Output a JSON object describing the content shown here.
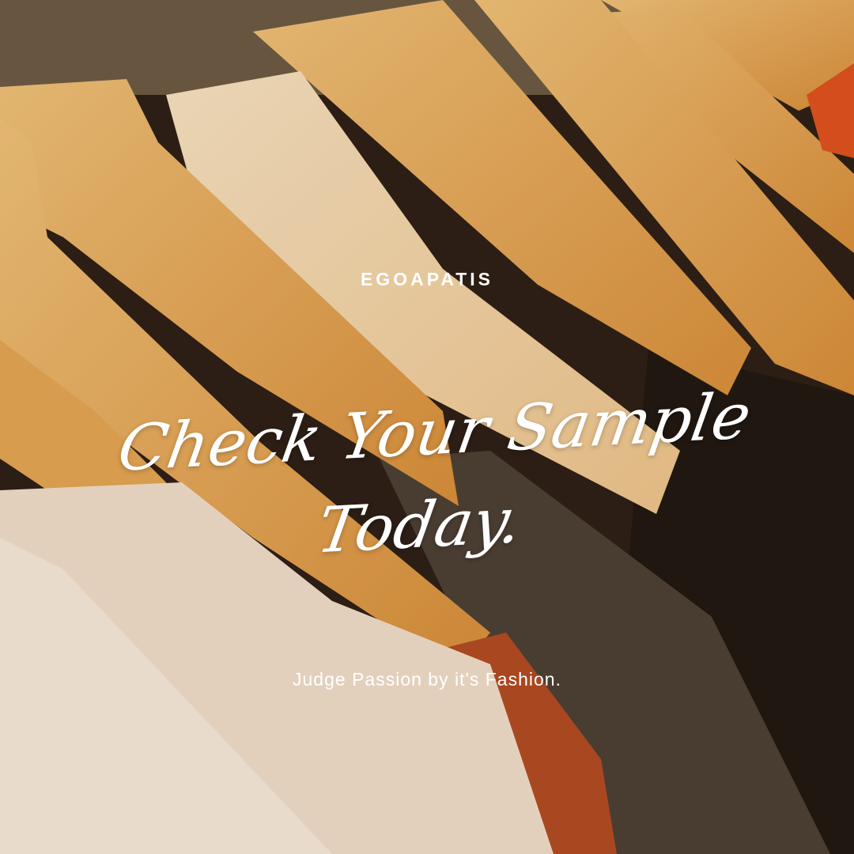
{
  "brand": "EGOAPATIS",
  "headline": {
    "line1": "Check Your Sample",
    "line2": "Today."
  },
  "tagline": "Judge Passion by it's Fashion.",
  "colors": {
    "wood": "#e0a04a",
    "wood_light": "#f2d6a8",
    "shirt_white": "#f0ddc8",
    "dark_cloth": "#1f1712",
    "rust": "#b24a22"
  }
}
